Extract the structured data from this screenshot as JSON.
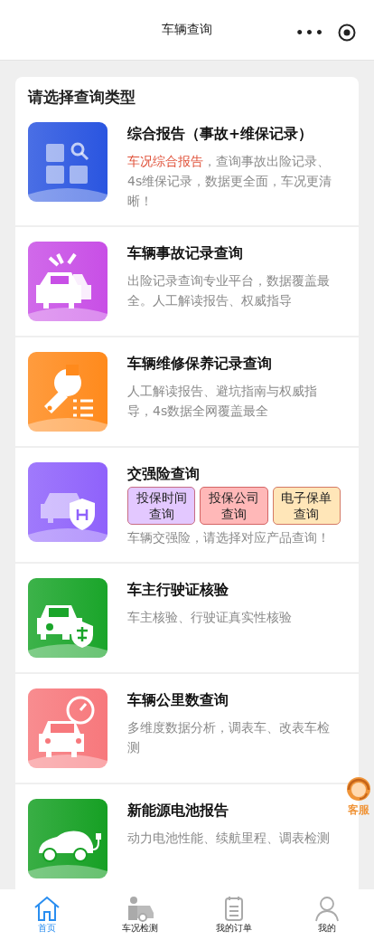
{
  "header": {
    "title": "车辆查询",
    "menu": "•••"
  },
  "section": {
    "title": "请选择查询类型"
  },
  "items": [
    {
      "kind": "grid",
      "color": "#2a55e0",
      "title": "综合报告（事故+维保记录）",
      "desc_highlight": "车况综合报告",
      "desc": "，查询事故出险记录、4s维保记录，数据更全面，车况更清晰！"
    },
    {
      "kind": "crash",
      "color": "#c84fe6",
      "title": "车辆事故记录查询",
      "desc": "出险记录查询专业平台，数据覆盖最全。人工解读报告、权威指导"
    },
    {
      "kind": "wrench",
      "color": "#ff8a1c",
      "title": "车辆维修保养记录查询",
      "desc": "人工解读报告、避坑指南与权威指导，4s数据全网覆盖最全"
    },
    {
      "kind": "shield",
      "color": "#8f62fb",
      "title": "交强险查询",
      "buttons": [
        {
          "label": "投保时间查询",
          "color": "#e3c8ff"
        },
        {
          "label": "投保公司查询",
          "color": "#ffb8b8"
        },
        {
          "label": "电子保单查询",
          "color": "#ffe6b8"
        }
      ],
      "desc": "车辆交强险，请选择对应产品查询！"
    },
    {
      "kind": "verify",
      "color": "#1aa52a",
      "title": "车主行驶证核验",
      "desc": "车主核验、行驶证真实性核验"
    },
    {
      "kind": "gauge",
      "color": "#f7787c",
      "title": "车辆公里数查询",
      "desc": "多维度数据分析，调表车、改表车检测"
    },
    {
      "kind": "ev",
      "color": "#16a024",
      "title": "新能源电池报告",
      "desc": "动力电池性能、续航里程、调表检测"
    }
  ],
  "service": {
    "label": "客服"
  },
  "nav": [
    {
      "label": "首页",
      "selected": true
    },
    {
      "label": "车况检测",
      "selected": false
    },
    {
      "label": "我的订单",
      "selected": false
    },
    {
      "label": "我的",
      "selected": false
    }
  ]
}
